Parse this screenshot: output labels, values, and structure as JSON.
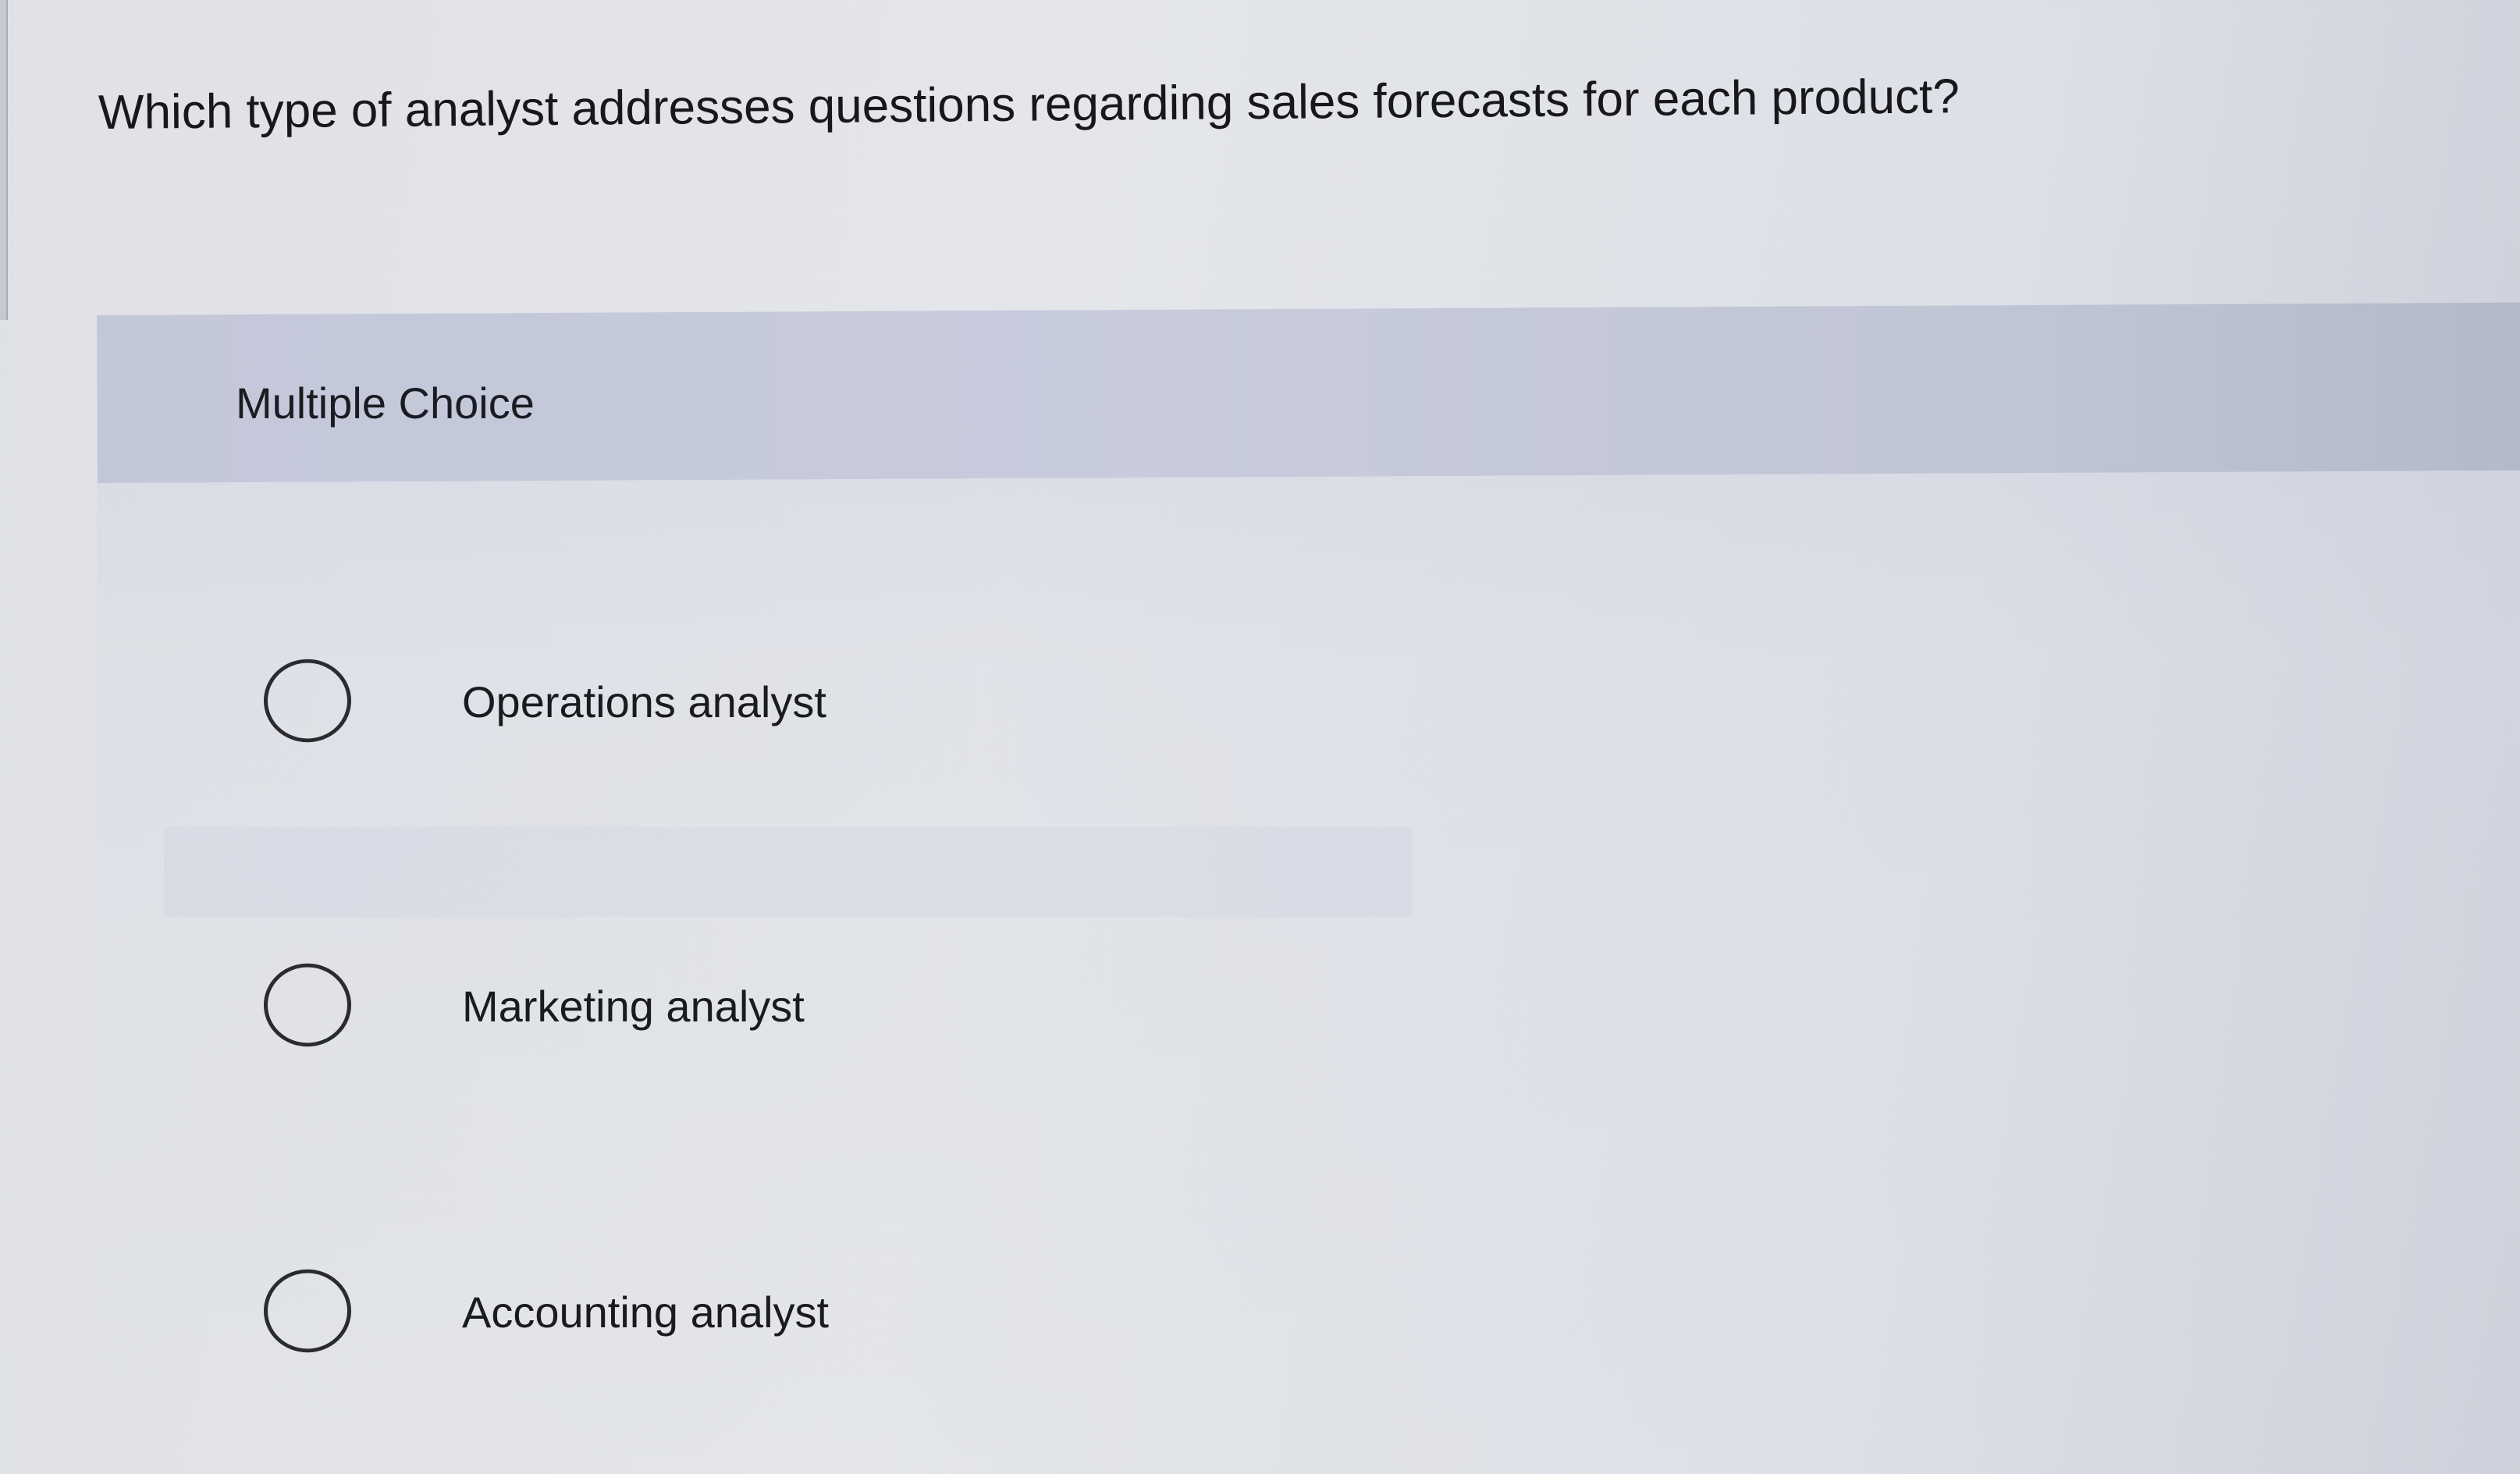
{
  "question": {
    "text": "Which type of analyst addresses questions regarding sales forecasts for each product?"
  },
  "panel": {
    "header_label": "Multiple Choice"
  },
  "options": [
    {
      "label": "Operations analyst",
      "selected": false
    },
    {
      "label": "Marketing analyst",
      "selected": false
    },
    {
      "label": "Accounting analyst",
      "selected": false
    }
  ]
}
